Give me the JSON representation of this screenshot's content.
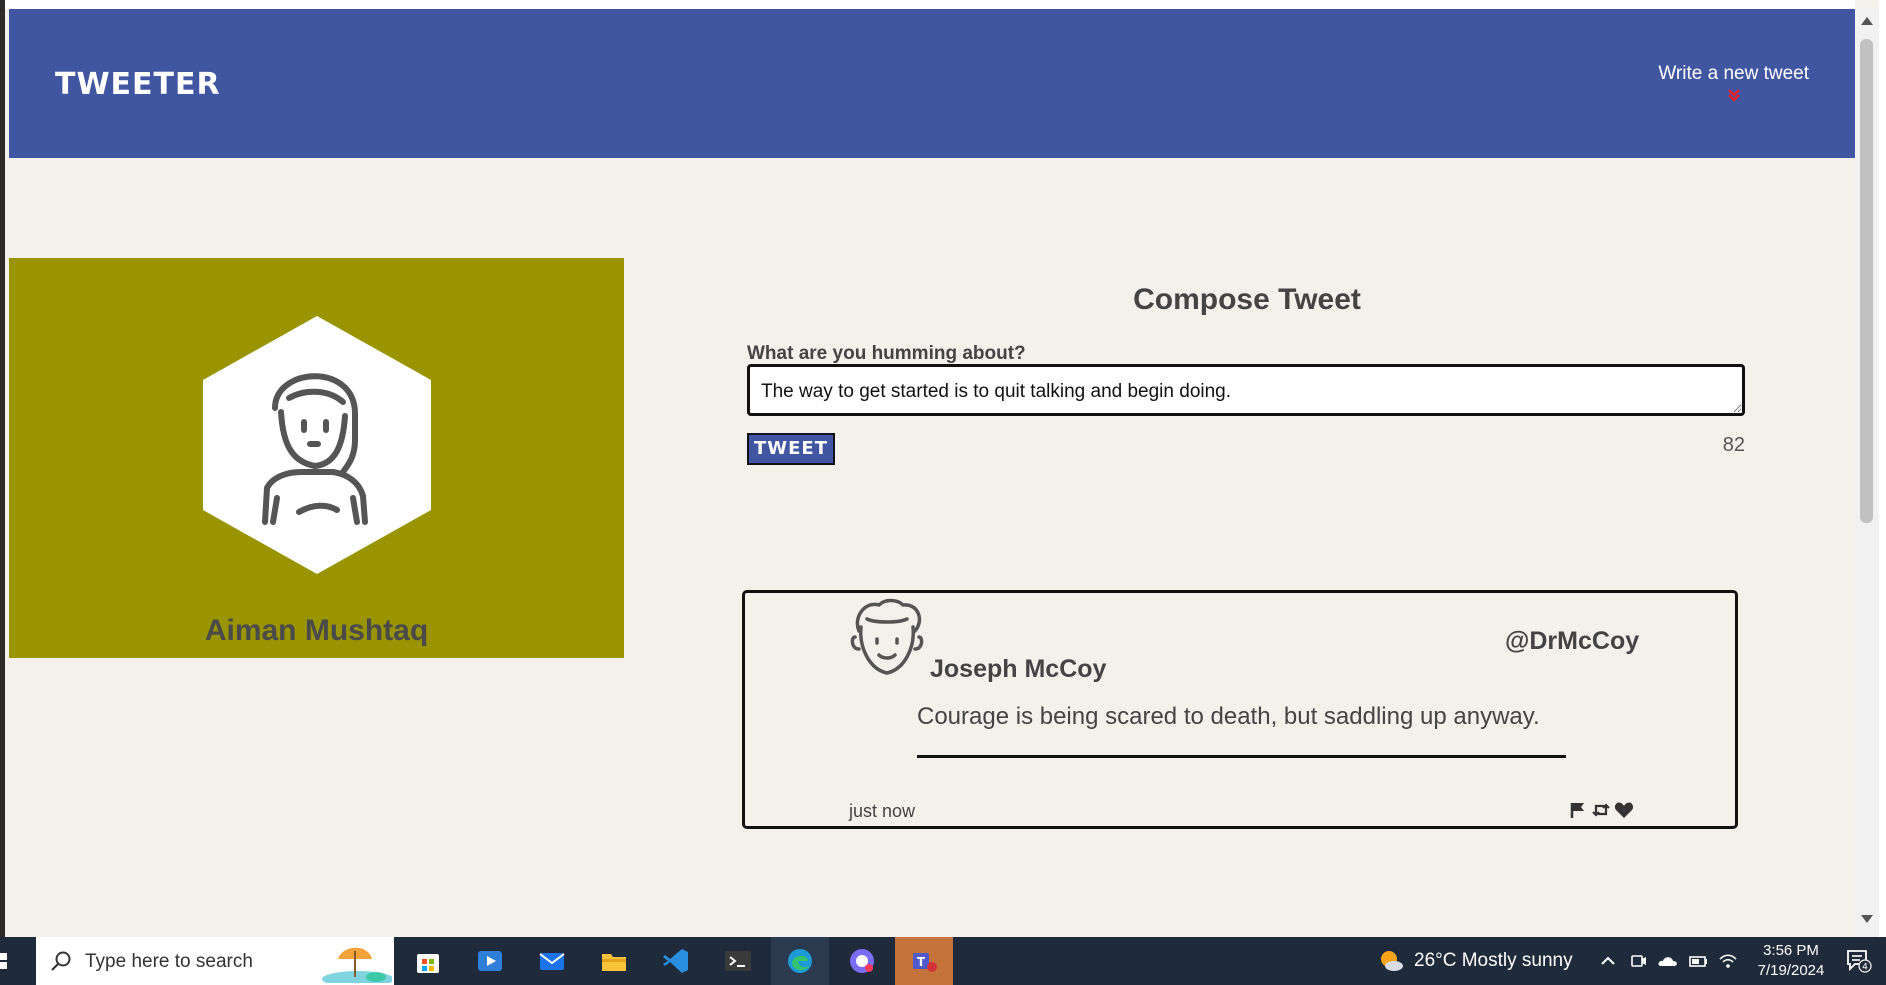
{
  "nav": {
    "brand": "TWEETER",
    "write_link": "Write a new tweet",
    "accent": "#e8222c"
  },
  "profile": {
    "name": "Aiman Mushtaq",
    "bg_color": "#9a9400"
  },
  "compose": {
    "title": "Compose Tweet",
    "label": "What are you humming about?",
    "text": "The way to get started is to quit talking and begin doing.",
    "button": "TWEET",
    "counter": "82"
  },
  "tweet": {
    "name": "Joseph McCoy",
    "handle": "@DrMcCoy",
    "text": "Courage is being scared to death, but saddling up anyway.",
    "time": "just now",
    "actions": [
      "flag-icon",
      "retweet-icon",
      "heart-icon"
    ]
  },
  "taskbar": {
    "search_placeholder": "Type here to search",
    "apps": [
      "store-icon",
      "media-player-icon",
      "mail-icon",
      "file-explorer-icon",
      "vscode-icon",
      "terminal-icon",
      "edge-icon",
      "chat-app-icon",
      "teams-icon"
    ],
    "weather": "26°C  Mostly sunny",
    "time": "3:56 PM",
    "date": "7/19/2024",
    "notifications": "4"
  },
  "colors": {
    "nav_bg": "#4056a1",
    "page_bg": "#f4f1ed",
    "taskbar_bg": "#1f2a3a"
  }
}
